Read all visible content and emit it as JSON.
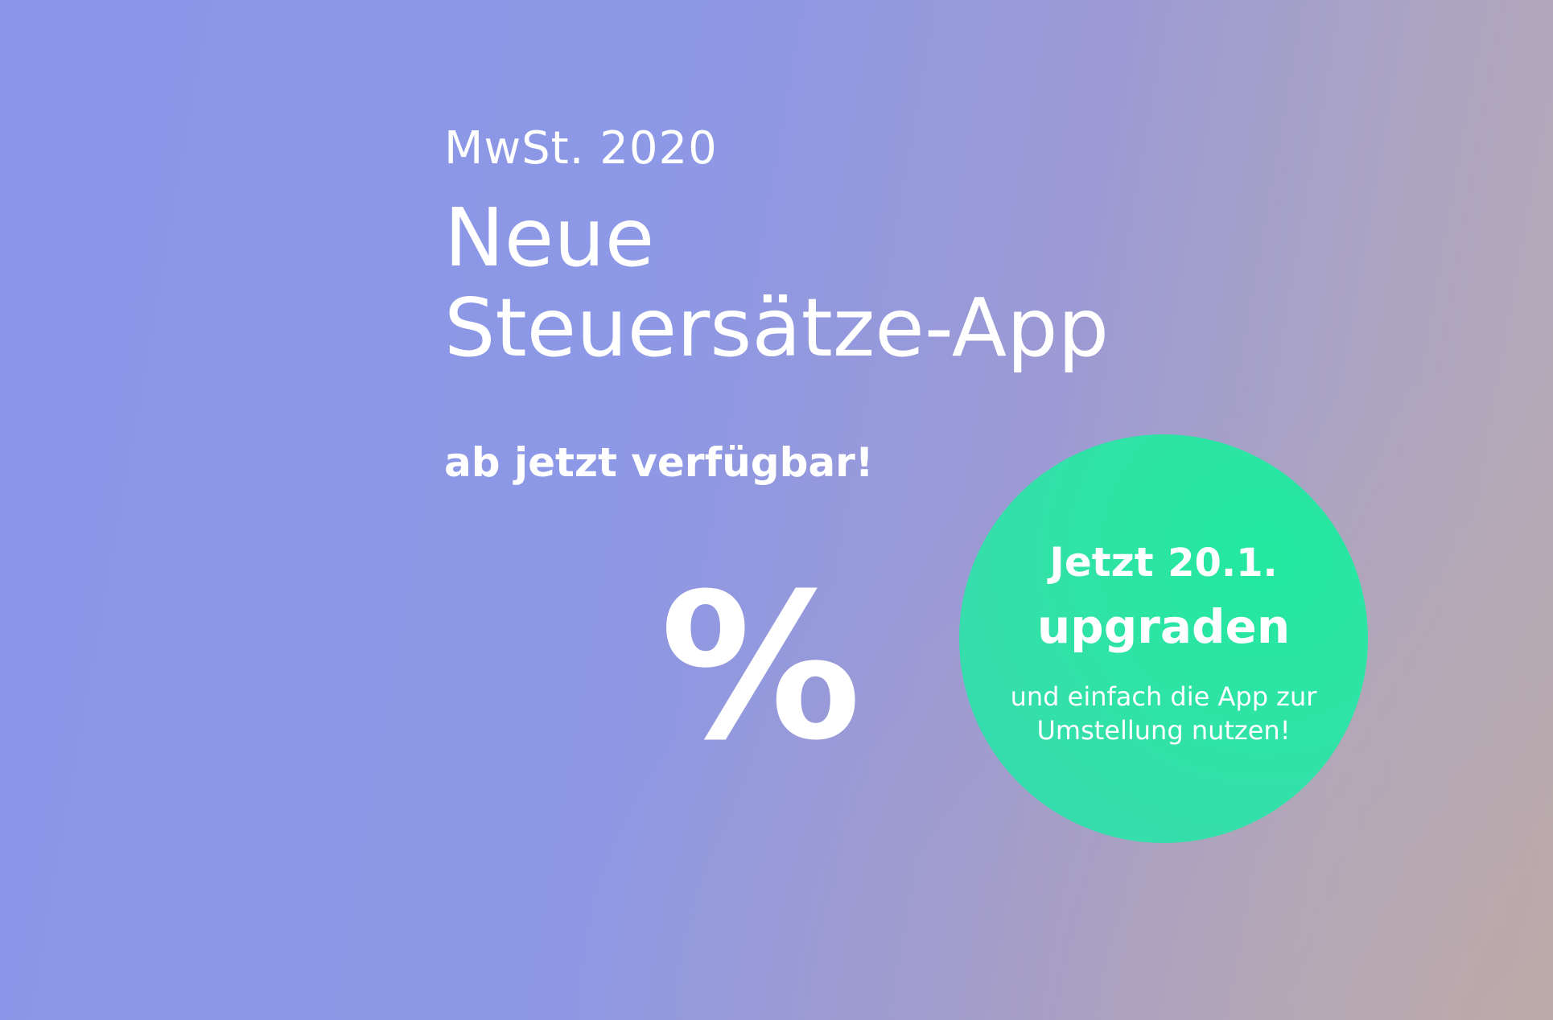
{
  "banner": {
    "kicker": "MwSt. 2020",
    "headline": [
      "Neue",
      "Steuersätze-App"
    ],
    "subline": "ab jetzt verfügbar!",
    "percent_symbol": "%"
  },
  "badge": {
    "line1_prefix": "Jetzt",
    "line1_date": "20.1.",
    "line2": "upgraden",
    "small_text": [
      "und einfach die App zur",
      "Umstellung nutzen!"
    ],
    "color": "#2ee3a5"
  },
  "colors": {
    "background_start": "#8a96e8",
    "background_end": "#b6aab2",
    "text": "#ffffff"
  }
}
